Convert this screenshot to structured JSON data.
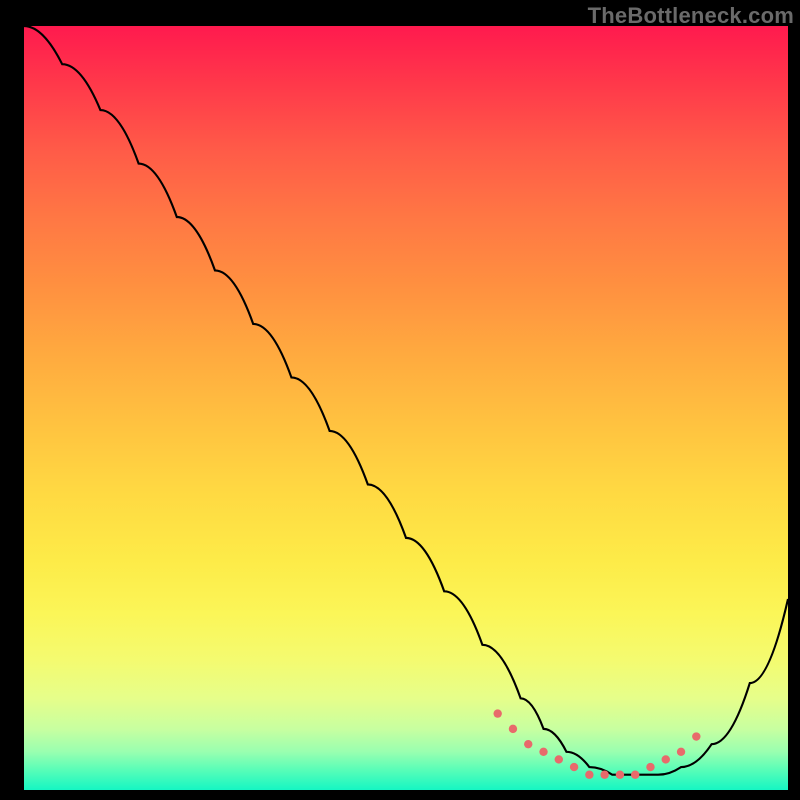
{
  "watermark": "TheBottleneck.com",
  "chart_data": {
    "type": "line",
    "title": "",
    "xlabel": "",
    "ylabel": "",
    "xlim": [
      0,
      100
    ],
    "ylim": [
      0,
      100
    ],
    "grid": false,
    "legend": false,
    "background": "rainbow-gradient-red-top-green-bottom",
    "series": [
      {
        "name": "bottleneck-curve",
        "color": "#000000",
        "x": [
          0,
          5,
          10,
          15,
          20,
          25,
          30,
          35,
          40,
          45,
          50,
          55,
          60,
          65,
          68,
          71,
          74,
          77,
          80,
          83,
          86,
          90,
          95,
          100
        ],
        "values": [
          100,
          95,
          89,
          82,
          75,
          68,
          61,
          54,
          47,
          40,
          33,
          26,
          19,
          12,
          8,
          5,
          3,
          2,
          2,
          2,
          3,
          6,
          14,
          25
        ]
      },
      {
        "name": "optimal-region-dotted",
        "color": "#e86a6b",
        "style": "dotted",
        "x": [
          62,
          64,
          66,
          68,
          70,
          72,
          74,
          76,
          78,
          80,
          82,
          84,
          86,
          88
        ],
        "values": [
          10,
          8,
          6,
          5,
          4,
          3,
          2,
          2,
          2,
          2,
          3,
          4,
          5,
          7
        ]
      }
    ]
  },
  "colors": {
    "frame": "#000000",
    "curve": "#000000",
    "dots": "#e86a6b"
  }
}
